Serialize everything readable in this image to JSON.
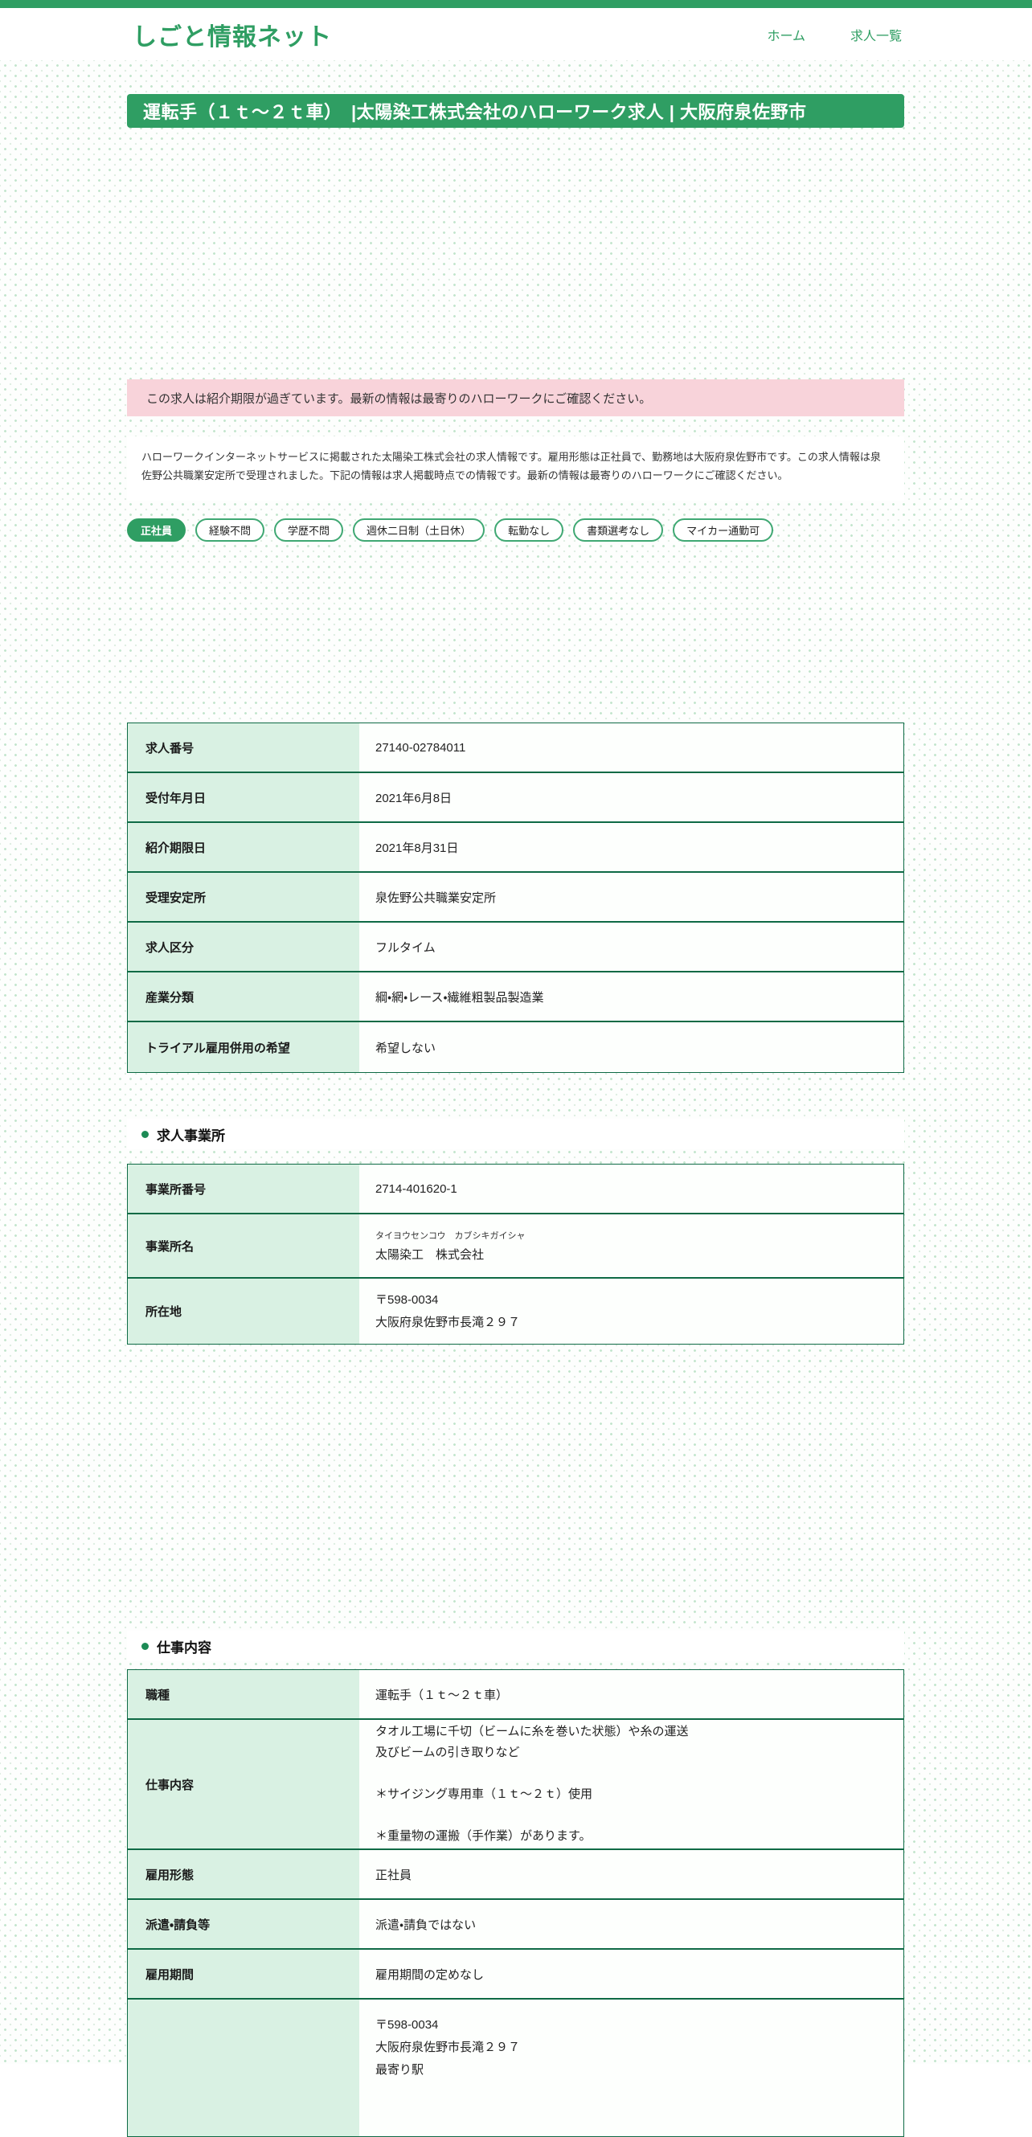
{
  "colors": {
    "primary_green": "#2f9e63",
    "table_border_green": "#0e6a45",
    "label_cell_green": "#d9f1e3",
    "alert_pink": "#f8d3da",
    "pattern_green": "#c3e5cd"
  },
  "header": {
    "site_title": "しごと情報ネット",
    "nav": [
      {
        "label": "ホーム"
      },
      {
        "label": "求人一覧"
      }
    ]
  },
  "banner": {
    "title": "運転手（１ｔ～２ｔ車）　|太陽染工株式会社のハローワーク求人 | 大阪府泉佐野市"
  },
  "alert": {
    "text": "この求人は紹介期限が過ぎています。最新の情報は最寄りのハローワークにご確認ください。"
  },
  "intro": {
    "text": "ハローワークインターネットサービスに掲載された太陽染工株式会社の求人情報です。雇用形態は正社員で、勤務地は大阪府泉佐野市です。この求人情報は泉佐野公共職業安定所で受理されました。下記の情報は求人掲載時点での情報です。最新の情報は最寄りのハローワークにご確認ください。"
  },
  "badges": [
    {
      "label": "正社員",
      "filled": true
    },
    {
      "label": "経験不問",
      "filled": false
    },
    {
      "label": "学歴不問",
      "filled": false
    },
    {
      "label": "週休二日制（土日休）",
      "filled": false
    },
    {
      "label": "転勤なし",
      "filled": false
    },
    {
      "label": "書類選考なし",
      "filled": false
    },
    {
      "label": "マイカー通勤可",
      "filled": false
    }
  ],
  "overview_table": {
    "rows": [
      {
        "label": "求人番号",
        "value": "27140-02784011"
      },
      {
        "label": "受付年月日",
        "value": "2021年6月8日"
      },
      {
        "label": "紹介期限日",
        "value": "2021年8月31日"
      },
      {
        "label": "受理安定所",
        "value": "泉佐野公共職業安定所"
      },
      {
        "label": "求人区分",
        "value": "フルタイム"
      },
      {
        "label": "産業分類",
        "value": "綱・網・レース・繊維粗製品製造業"
      },
      {
        "label": "トライアル雇用併用の希望",
        "value": "希望しない"
      }
    ]
  },
  "employer_section": {
    "heading": "求人事業所"
  },
  "employer_table": {
    "rows": [
      {
        "label": "事業所番号",
        "value": "2714-401620-1"
      },
      {
        "label": "事業所名",
        "kana": "タイヨウセンコウ　カブシキガイシャ",
        "name": "太陽染工　株式会社"
      },
      {
        "label": "所在地",
        "value": [
          "〒598-0034",
          "大阪府泉佐野市長滝２９７"
        ]
      }
    ]
  },
  "job_section": {
    "heading": "仕事内容"
  },
  "job_table": {
    "rows": [
      {
        "label": "職種",
        "value": "運転手（１ｔ～２ｔ車）"
      },
      {
        "label": "仕事内容",
        "value": [
          "タオル工場に千切（ビームに糸を巻いた状態）や糸の運送",
          "及びビームの引き取りなど",
          "",
          "＊サイジング専用車（１ｔ～２ｔ）使用",
          "",
          "＊重量物の運搬（手作業）があります。"
        ]
      },
      {
        "label": "雇用形態",
        "value": "正社員"
      },
      {
        "label": "派遣・請負等",
        "value": "派遣・請負ではない"
      },
      {
        "label": "雇用期間",
        "value": "雇用期間の定めなし"
      },
      {
        "label": "",
        "value": [
          "〒598-0034",
          "大阪府泉佐野市長滝２９７",
          "最寄り駅"
        ]
      }
    ]
  }
}
